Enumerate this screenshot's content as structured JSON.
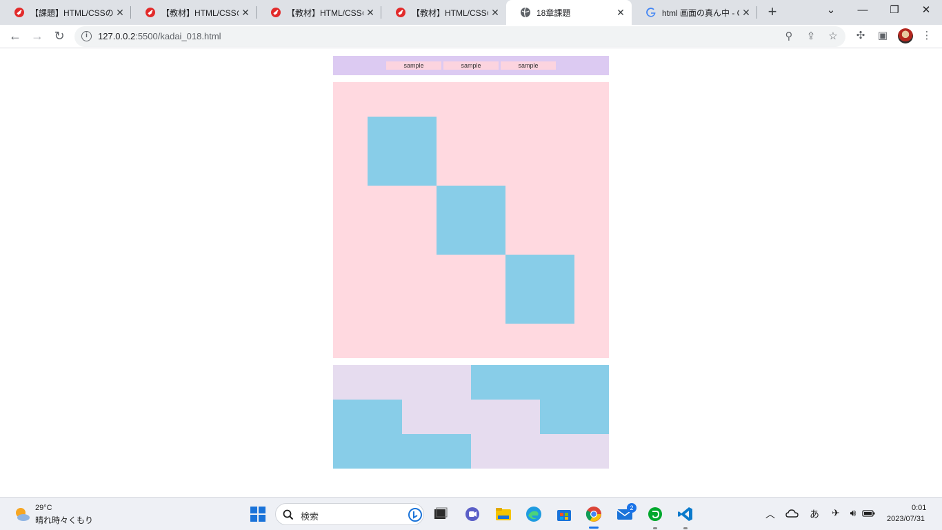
{
  "browser": {
    "tabs": [
      {
        "title": "【課題】HTML/CSSの基礎",
        "icon": "red-swirl-icon"
      },
      {
        "title": "【教材】HTML/CSSの基礎",
        "icon": "red-swirl-icon"
      },
      {
        "title": "【教材】HTML/CSSの基礎",
        "icon": "red-swirl-icon"
      },
      {
        "title": "【教材】HTML/CSSの基礎",
        "icon": "red-swirl-icon"
      },
      {
        "title": "18章課題",
        "icon": "globe-icon",
        "active": true
      },
      {
        "title": "html 画面の真ん中 - Google",
        "icon": "google-g-icon"
      }
    ],
    "address": {
      "host": "127.0.0.2",
      "rest": ":5500/kadai_018.html"
    }
  },
  "page": {
    "nav_items": [
      "sample",
      "sample",
      "sample"
    ],
    "colors": {
      "header": "#dccaf2",
      "nav_item": "#fcd4df",
      "main": "#ffd9e0",
      "box": "#88cde8",
      "footer": "#e6dcef"
    }
  },
  "taskbar": {
    "weather": {
      "temp": "29°C",
      "condition": "晴れ時々くもり"
    },
    "search_label": "検索",
    "mail_badge": "2",
    "ime": "あ",
    "time": "0:01",
    "date": "2023/07/31"
  }
}
